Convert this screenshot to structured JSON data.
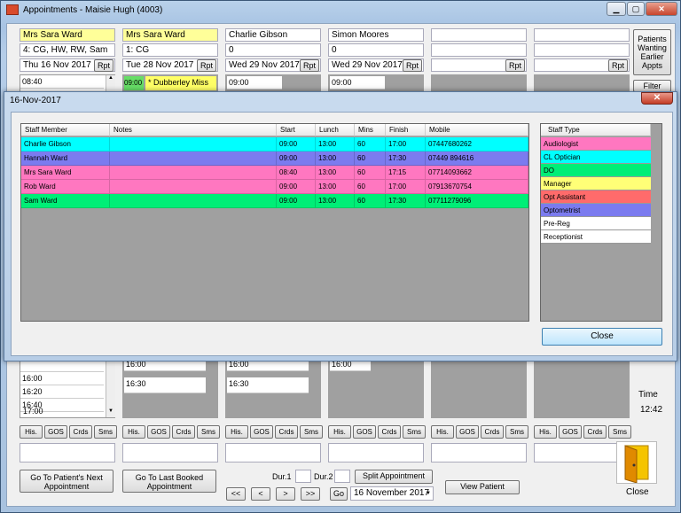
{
  "window": {
    "title": "Appointments - Maisie Hugh (4003)",
    "min": "▁",
    "max": "▢",
    "close": "✕"
  },
  "columns": [
    {
      "name": "Mrs Sara Ward",
      "line2": "4: CG, HW, RW, Sam",
      "date": "Thu 16 Nov 2017",
      "rpt": "Rpt",
      "highlight": true
    },
    {
      "name": "Mrs Sara Ward",
      "line2": "1: CG",
      "date": "Tue 28 Nov 2017",
      "rpt": "Rpt",
      "highlight": true
    },
    {
      "name": "Charlie Gibson",
      "line2": "0",
      "date": "Wed 29 Nov 2017",
      "rpt": "Rpt",
      "highlight": false
    },
    {
      "name": "Simon Moores",
      "line2": "0",
      "date": "Wed 29 Nov 2017",
      "rpt": "Rpt",
      "highlight": false
    },
    {
      "name": "",
      "line2": "",
      "date": "",
      "rpt": "Rpt",
      "highlight": false
    },
    {
      "name": "",
      "line2": "",
      "date": "",
      "rpt": "Rpt",
      "highlight": false
    }
  ],
  "side": {
    "patients_waiting": "Patients Wanting Earlier Appts",
    "filter": "Filter",
    "time_label": "Time",
    "time_value": "12:42",
    "close_label": "Close"
  },
  "slots": {
    "col1_top": "08:40",
    "col2_top": "09:00",
    "col2_appt": "* Dubberley Miss",
    "col3_top": "09:00",
    "col4_top": "09:00",
    "col1_bottom": [
      "16:00",
      "16:20",
      "16:40",
      "17:00"
    ],
    "col2_bottom": [
      "16:00",
      "16:30"
    ],
    "col3_bottom": [
      "16:00",
      "16:30"
    ],
    "col4_bottom": [
      "16:00"
    ]
  },
  "small_buttons": [
    "His.",
    "GOS",
    "Crds",
    "Sms"
  ],
  "bottom": {
    "next_appt": "Go To Patient's Next Appointment",
    "last_booked": "Go To Last Booked Appointment",
    "dur1": "Dur.1",
    "dur2": "Dur.2",
    "split": "Split Appointment",
    "view_patient": "View Patient",
    "nav_first": "<<",
    "nav_prev": "<",
    "nav_next": ">",
    "nav_last": ">>",
    "go": "Go",
    "date_value": "16 November 2017"
  },
  "dialog": {
    "title": "16-Nov-2017",
    "close_x": "✕",
    "close_button": "Close",
    "headers": [
      "Staff Member",
      "Notes",
      "Start",
      "Lunch",
      "Mins",
      "Finish",
      "Mobile"
    ],
    "rows": [
      {
        "staff": "Charlie Gibson",
        "notes": "",
        "start": "09:00",
        "lunch": "13:00",
        "mins": "60",
        "finish": "17:00",
        "mobile": "07447680262",
        "color": "#00ffff"
      },
      {
        "staff": "Hannah Ward",
        "notes": "",
        "start": "09:00",
        "lunch": "13:00",
        "mins": "60",
        "finish": "17:30",
        "mobile": "07449 894616",
        "color": "#7b7bef"
      },
      {
        "staff": "Mrs Sara Ward",
        "notes": "",
        "start": "08:40",
        "lunch": "13:00",
        "mins": "60",
        "finish": "17:15",
        "mobile": "07714093662",
        "color": "#ff77c0"
      },
      {
        "staff": "Rob Ward",
        "notes": "",
        "start": "09:00",
        "lunch": "13:00",
        "mins": "60",
        "finish": "17:00",
        "mobile": "07913670754",
        "color": "#ff77c0"
      },
      {
        "staff": "Sam Ward",
        "notes": "",
        "start": "09:00",
        "lunch": "13:00",
        "mins": "60",
        "finish": "17:30",
        "mobile": "07711279096",
        "color": "#00ee77"
      }
    ],
    "types_header": "Staff Type",
    "types": [
      {
        "label": "Audiologist",
        "color": "#ff77c0"
      },
      {
        "label": "CL Optician",
        "color": "#00ffff"
      },
      {
        "label": "DO",
        "color": "#00ee77"
      },
      {
        "label": "Manager",
        "color": "#ffff77"
      },
      {
        "label": "Opt Assistant",
        "color": "#ff6b6b"
      },
      {
        "label": "Optometrist",
        "color": "#7b7bef"
      },
      {
        "label": "Pre-Reg",
        "color": "#ffffff"
      },
      {
        "label": "Receptionist",
        "color": "#ffffff"
      }
    ]
  }
}
